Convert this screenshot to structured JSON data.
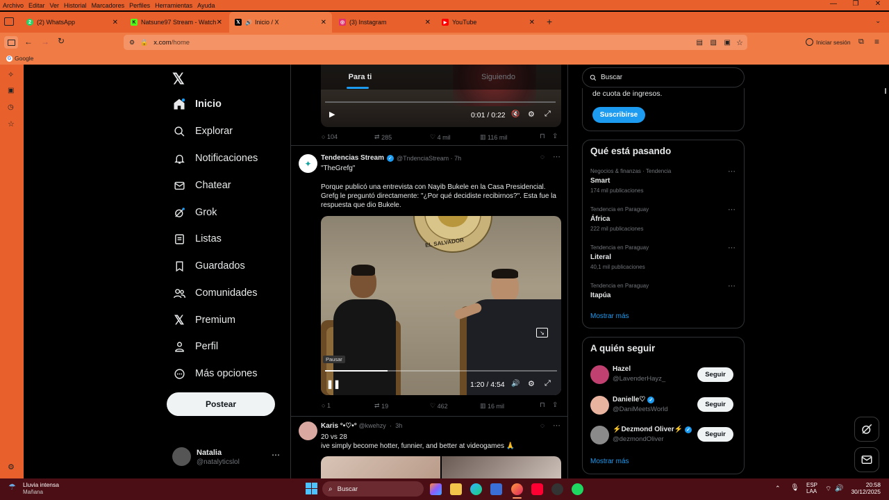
{
  "menubar": {
    "items": [
      "Archivo",
      "Editar",
      "Ver",
      "Historial",
      "Marcadores",
      "Perfiles",
      "Herramientas",
      "Ayuda"
    ]
  },
  "tabs": [
    {
      "label": "(2) WhatsApp",
      "icon": "whatsapp-icon",
      "color": "#25d366"
    },
    {
      "label": "Natsune97 Stream - Watch Live",
      "icon": "kick-icon",
      "color": "#53fc18"
    },
    {
      "label": "Inicio / X",
      "icon": "x-logo-icon",
      "color": "#000000",
      "active": true
    },
    {
      "label": "(3) Instagram",
      "icon": "instagram-icon",
      "color": "#e1306c"
    },
    {
      "label": "YouTube",
      "icon": "youtube-icon",
      "color": "#ff0000"
    }
  ],
  "url": {
    "host": "x.com",
    "path": "/home"
  },
  "account_label": "Iniciar sesión",
  "bookmarks": [
    {
      "label": "Google"
    }
  ],
  "nav": [
    {
      "label": "Inicio",
      "icon": "home-icon"
    },
    {
      "label": "Explorar",
      "icon": "search-icon"
    },
    {
      "label": "Notificaciones",
      "icon": "bell-icon"
    },
    {
      "label": "Chatear",
      "icon": "mail-icon"
    },
    {
      "label": "Grok",
      "icon": "grok-icon"
    },
    {
      "label": "Listas",
      "icon": "list-icon"
    },
    {
      "label": "Guardados",
      "icon": "bookmark-icon"
    },
    {
      "label": "Comunidades",
      "icon": "communities-icon"
    },
    {
      "label": "Premium",
      "icon": "x-logo-icon"
    },
    {
      "label": "Perfil",
      "icon": "person-icon"
    },
    {
      "label": "Más opciones",
      "icon": "more-circle-icon"
    }
  ],
  "post_button": "Postear",
  "user": {
    "name": "Natalia",
    "handle": "@natalyticslol"
  },
  "timeline_tabs": {
    "for_you": "Para ti",
    "following": "Siguiendo"
  },
  "tweet1": {
    "video_time": "0:01 / 0:22",
    "replies": "104",
    "reposts": "285",
    "likes": "4 mil",
    "views": "116 mil"
  },
  "tweet2": {
    "name": "Tendencias Stream",
    "handle": "@TndenciaStream",
    "time": "7h",
    "text1": "\"TheGrefg\"",
    "text2": "Porque publicó una entrevista con Nayib Bukele en la Casa Presidencial. Grefg le preguntó directamente: \"¿Por qué decidiste recibirnos?\". Esta fue la respuesta que dio Bukele.",
    "seal_text": "EL SALVADOR",
    "tooltip": "Pausar",
    "video_time": "1:20 / 4:54",
    "video_progress": 0.27,
    "replies": "1",
    "reposts": "19",
    "likes": "462",
    "views": "16 mil"
  },
  "tweet3": {
    "name": "Karis °•♡•°",
    "handle": "@kwehzy",
    "time": "3h",
    "text1": "20 vs 28",
    "text2": "ive simply become hotter, funnier, and better at videogames 🙏"
  },
  "search": {
    "placeholder": "Buscar"
  },
  "premium_card": {
    "text": "de cuota de ingresos.",
    "button": "Suscribirse"
  },
  "trends": {
    "title": "Qué está pasando",
    "items": [
      {
        "category": "Negocios & finanzas · Tendencia",
        "name": "Smart",
        "count": "174 mil publicaciones"
      },
      {
        "category": "Tendencia en Paraguay",
        "name": "África",
        "count": "222 mil publicaciones"
      },
      {
        "category": "Tendencia en Paraguay",
        "name": "Literal",
        "count": "40,1 mil publicaciones"
      },
      {
        "category": "Tendencia en Paraguay",
        "name": "Itapúa",
        "count": ""
      }
    ],
    "show_more": "Mostrar más"
  },
  "who_to_follow": {
    "title": "A quién seguir",
    "items": [
      {
        "name": "Hazel",
        "handle": "@LavenderHayz_",
        "verified": false,
        "button": "Seguir",
        "avatar_color": "#c04070"
      },
      {
        "name": "Danielle♡",
        "handle": "@DaniMeetsWorld",
        "verified": true,
        "button": "Seguir",
        "avatar_color": "#e8b4a0"
      },
      {
        "name": "⚡Dezmond Oliver⚡",
        "handle": "@dezmondOliver",
        "verified": true,
        "button": "Seguir",
        "avatar_color": "#8a8a8a"
      }
    ],
    "show_more": "Mostrar más"
  },
  "taskbar": {
    "weather": {
      "title": "Lluvia intensa",
      "subtitle": "Mañana"
    },
    "search": "Buscar",
    "lang": {
      "line1": "ESP",
      "line2": "LAA"
    },
    "clock": {
      "time": "20:58",
      "date": "30/12/2025"
    }
  },
  "colors": {
    "brand_orange": "#e8602c",
    "x_blue": "#1d9bf0",
    "taskbar": "#4a0e14"
  }
}
